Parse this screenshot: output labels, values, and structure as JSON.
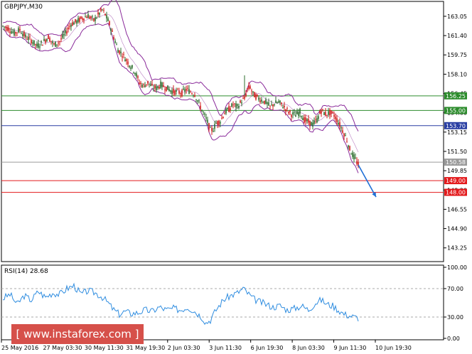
{
  "window": {
    "symbol_label": "GBPJPY,M30"
  },
  "watermark": {
    "text": "[ www.instaforex.com ]"
  },
  "colors": {
    "up_candle": "#2d6d2d",
    "down_candle": "#d11a1a",
    "bollinger": "#8a2a9a",
    "rsi_line": "#2f8de0",
    "level_green": "#2d8c2d",
    "level_blue": "#2a3fa3",
    "level_red": "#e31a1c",
    "level_grey": "#9a9a9a",
    "arrow": "#1f6fd6"
  },
  "chart_data": [
    {
      "type": "candlestick",
      "title": "GBPJPY,M30",
      "ylim": [
        142.2,
        164.2
      ],
      "price_ticks": [
        "163.05",
        "161.40",
        "159.75",
        "158.10",
        "156.45",
        "154.80",
        "153.15",
        "151.50",
        "149.85",
        "148.20",
        "146.55",
        "144.90",
        "143.25"
      ],
      "time_ticks": [
        "25 May 2016",
        "27 May 03:30",
        "30 May 11:30",
        "31 May 19:30",
        "2 Jun 03:30",
        "3 Jun 11:30",
        "6 Jun 19:30",
        "8 Jun 03:30",
        "9 Jun 11:30",
        "10 Jun 19:30"
      ],
      "close_path": [
        [
          0,
          162.2
        ],
        [
          8,
          162.0
        ],
        [
          16,
          161.6
        ],
        [
          24,
          161.9
        ],
        [
          32,
          161.3
        ],
        [
          40,
          161.0
        ],
        [
          48,
          160.5
        ],
        [
          56,
          160.8
        ],
        [
          64,
          161.3
        ],
        [
          72,
          160.6
        ],
        [
          80,
          160.9
        ],
        [
          88,
          161.6
        ],
        [
          96,
          162.4
        ],
        [
          104,
          162.6
        ],
        [
          112,
          162.9
        ],
        [
          120,
          163.1
        ],
        [
          128,
          162.7
        ],
        [
          136,
          163.3
        ],
        [
          140,
          163.6
        ],
        [
          144,
          163.2
        ],
        [
          150,
          162.4
        ],
        [
          156,
          161.3
        ],
        [
          162,
          160.2
        ],
        [
          168,
          159.8
        ],
        [
          174,
          159.3
        ],
        [
          180,
          158.8
        ],
        [
          186,
          158.3
        ],
        [
          192,
          157.4
        ],
        [
          198,
          157.1
        ],
        [
          204,
          157.4
        ],
        [
          210,
          157.0
        ],
        [
          216,
          156.9
        ],
        [
          222,
          157.2
        ],
        [
          228,
          157.0
        ],
        [
          234,
          156.8
        ],
        [
          240,
          156.6
        ],
        [
          246,
          156.6
        ],
        [
          252,
          156.5
        ],
        [
          258,
          156.8
        ],
        [
          264,
          156.6
        ],
        [
          270,
          156.4
        ],
        [
          276,
          155.6
        ],
        [
          282,
          154.8
        ],
        [
          288,
          154.0
        ],
        [
          292,
          153.3
        ],
        [
          296,
          153.4
        ],
        [
          300,
          153.9
        ],
        [
          306,
          154.1
        ],
        [
          312,
          154.8
        ],
        [
          318,
          155.1
        ],
        [
          324,
          155.5
        ],
        [
          330,
          155.3
        ],
        [
          336,
          155.8
        ],
        [
          340,
          156.0
        ],
        [
          344,
          156.8
        ],
        [
          348,
          157.0
        ],
        [
          352,
          156.4
        ],
        [
          358,
          156.1
        ],
        [
          364,
          155.9
        ],
        [
          370,
          155.7
        ],
        [
          376,
          155.3
        ],
        [
          382,
          155.6
        ],
        [
          388,
          155.7
        ],
        [
          394,
          155.4
        ],
        [
          400,
          155.0
        ],
        [
          406,
          154.7
        ],
        [
          412,
          154.6
        ],
        [
          418,
          154.9
        ],
        [
          424,
          154.2
        ],
        [
          430,
          154.0
        ],
        [
          436,
          153.8
        ],
        [
          442,
          154.2
        ],
        [
          448,
          155.0
        ],
        [
          454,
          154.7
        ],
        [
          460,
          154.8
        ],
        [
          466,
          154.6
        ],
        [
          472,
          154.0
        ],
        [
          478,
          153.3
        ],
        [
          484,
          152.5
        ],
        [
          488,
          151.7
        ],
        [
          492,
          151.2
        ],
        [
          496,
          150.8
        ],
        [
          500,
          150.35
        ]
      ],
      "levels": [
        {
          "label": "156.25",
          "value": 156.25,
          "kind": "resistance",
          "color": "#2d8c2d"
        },
        {
          "label": "155.00",
          "value": 155.0,
          "kind": "resistance",
          "color": "#2d8c2d"
        },
        {
          "label": "153.70",
          "value": 153.7,
          "kind": "resistance",
          "color": "#2a3fa3"
        },
        {
          "label": "150.58",
          "value": 150.58,
          "kind": "current",
          "color": "#9a9a9a"
        },
        {
          "label": "149.00",
          "value": 149.0,
          "kind": "target",
          "color": "#e31a1c"
        },
        {
          "label": "148.00",
          "value": 148.0,
          "kind": "target",
          "color": "#e31a1c"
        }
      ],
      "forecast_arrow": {
        "from": [
          500,
          150.35
        ],
        "to": [
          525,
          147.6
        ]
      }
    },
    {
      "type": "line",
      "title": "RSI(14) 28.68",
      "ylim": [
        0,
        100
      ],
      "ticks": [
        "100.00",
        "70.00",
        "30.00",
        "0.00"
      ],
      "guide_levels": [
        70,
        30
      ],
      "path": [
        [
          0,
          56
        ],
        [
          10,
          62
        ],
        [
          20,
          48
        ],
        [
          30,
          60
        ],
        [
          40,
          54
        ],
        [
          50,
          66
        ],
        [
          60,
          58
        ],
        [
          70,
          64
        ],
        [
          80,
          62
        ],
        [
          90,
          70
        ],
        [
          100,
          74
        ],
        [
          110,
          62
        ],
        [
          120,
          67
        ],
        [
          130,
          64
        ],
        [
          140,
          58
        ],
        [
          148,
          50
        ],
        [
          156,
          40
        ],
        [
          164,
          34
        ],
        [
          172,
          38
        ],
        [
          180,
          35
        ],
        [
          190,
          36
        ],
        [
          200,
          40
        ],
        [
          210,
          38
        ],
        [
          220,
          44
        ],
        [
          230,
          40
        ],
        [
          240,
          42
        ],
        [
          250,
          40
        ],
        [
          260,
          44
        ],
        [
          270,
          38
        ],
        [
          280,
          30
        ],
        [
          286,
          22
        ],
        [
          292,
          26
        ],
        [
          300,
          40
        ],
        [
          310,
          54
        ],
        [
          320,
          60
        ],
        [
          330,
          64
        ],
        [
          338,
          70
        ],
        [
          344,
          64
        ],
        [
          352,
          56
        ],
        [
          360,
          52
        ],
        [
          370,
          48
        ],
        [
          380,
          44
        ],
        [
          390,
          46
        ],
        [
          400,
          40
        ],
        [
          410,
          42
        ],
        [
          420,
          46
        ],
        [
          430,
          40
        ],
        [
          440,
          50
        ],
        [
          448,
          54
        ],
        [
          456,
          48
        ],
        [
          464,
          46
        ],
        [
          472,
          40
        ],
        [
          480,
          34
        ],
        [
          488,
          32
        ],
        [
          494,
          30
        ],
        [
          500,
          28.7
        ]
      ]
    }
  ]
}
